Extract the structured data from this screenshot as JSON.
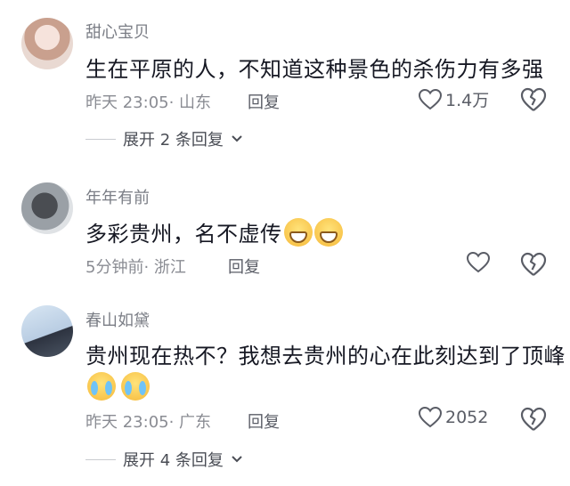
{
  "comments": [
    {
      "username": "甜心宝贝",
      "text": "生在平原的人，不知道这种景色的杀伤力有多强",
      "time": "昨天 23:05",
      "location": "· 山东",
      "reply_label": "回复",
      "likes": "1.4万",
      "expand_label": "展开 2 条回复"
    },
    {
      "username": "年年有前",
      "text": "多彩贵州，名不虚传",
      "emojis": [
        "grin-emoji",
        "grin-emoji"
      ],
      "time": "5分钟前",
      "location": "· 浙江",
      "reply_label": "回复",
      "likes": ""
    },
    {
      "username": "春山如黛",
      "text": "贵州现在热不？我想去贵州的心在此刻达到了顶峰",
      "emojis": [
        "cry-emoji",
        "cry-emoji"
      ],
      "time": "昨天 23:05",
      "location": "· 广东",
      "reply_label": "回复",
      "likes": "2052",
      "expand_label": "展开 4 条回复"
    }
  ],
  "icons": {
    "like": "heart-icon",
    "dislike": "broken-heart-icon",
    "expand": "chevron-down-icon"
  },
  "colors": {
    "primary_text": "#161823",
    "secondary_text": "#8a8c93",
    "username": "#7a7d85"
  }
}
